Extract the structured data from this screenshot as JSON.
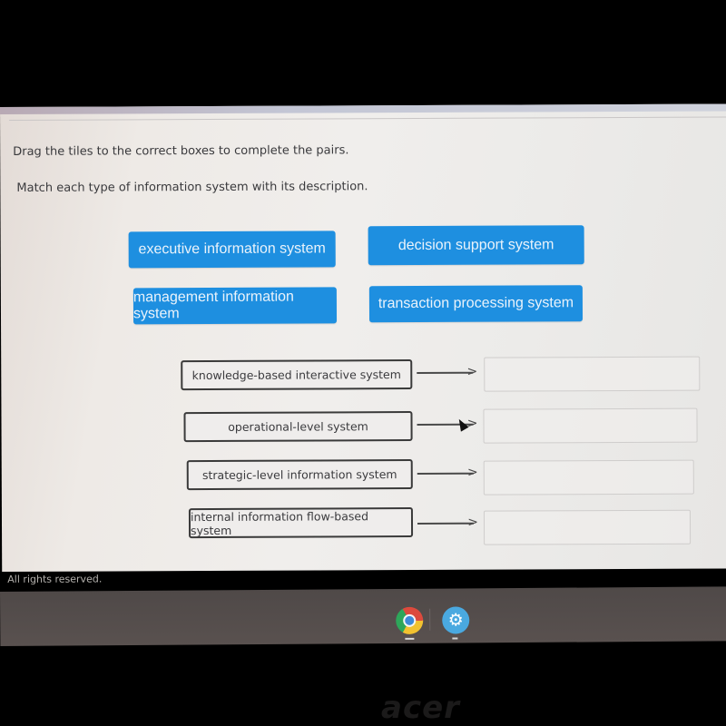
{
  "instructions": {
    "line1": "Drag the tiles to the correct boxes to complete the pairs.",
    "line2": "Match each type of information system with its description."
  },
  "tiles": [
    {
      "label": "executive information system"
    },
    {
      "label": "decision support system"
    },
    {
      "label": "management information system"
    },
    {
      "label": "transaction processing system"
    }
  ],
  "pairs": [
    {
      "description": "knowledge-based interactive system",
      "answer": ""
    },
    {
      "description": "operational-level system",
      "answer": ""
    },
    {
      "description": "strategic-level information system",
      "answer": ""
    },
    {
      "description": "internal information flow-based system",
      "answer": ""
    }
  ],
  "arrow_glyph": "→",
  "footer": "All rights reserved.",
  "shelf": {
    "apps": [
      {
        "name": "chrome"
      },
      {
        "name": "settings",
        "glyph": "⚙"
      }
    ]
  },
  "bezel_brand": "acer",
  "colors": {
    "tile_bg": "#1e8fe0",
    "tile_text": "#eaf3fb"
  }
}
